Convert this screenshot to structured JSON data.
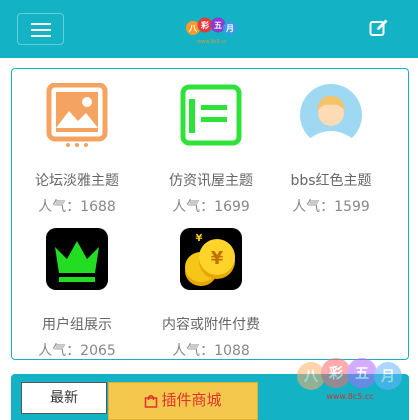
{
  "header": {
    "logo_text": "八彩五月",
    "logo_subtext": "www.8c5.cc",
    "accent": "#13b2c4"
  },
  "themes": [
    {
      "name": "论坛淡雅主题",
      "popularity": "人气：1688",
      "icon": "image-frame-icon",
      "color": "#f4a460"
    },
    {
      "name": "仿资讯屋主题",
      "popularity": "人气：1699",
      "icon": "document-icon",
      "color": "#2ee23a"
    },
    {
      "name": "bbs红色主题",
      "popularity": "人气：1599",
      "icon": "user-avatar-icon",
      "color": "#9ed8f2"
    },
    {
      "name": "用户组展示",
      "popularity": "人气：2065",
      "icon": "crown-icon",
      "color": "#22dd22"
    },
    {
      "name": "内容或附件付费",
      "popularity": "人气：1088",
      "icon": "gold-coins-icon",
      "color": "#f5c518"
    }
  ],
  "tabs": {
    "latest": "最新",
    "plugin_store": "插件商城"
  },
  "watermark": {
    "text": "八彩五月",
    "url": "www.8c5.cc"
  }
}
